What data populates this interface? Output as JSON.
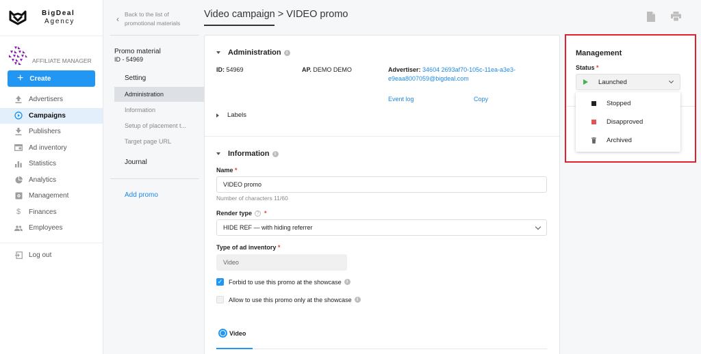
{
  "brand": {
    "name_line1": "BigDeal",
    "name_line2": "Agency",
    "role": "AFFILIATE MANAGER"
  },
  "sidebar": {
    "create_label": "Create",
    "items": [
      {
        "label": "Advertisers",
        "icon": "upload-icon",
        "active": false
      },
      {
        "label": "Campaigns",
        "icon": "play-circle-icon",
        "active": true
      },
      {
        "label": "Publishers",
        "icon": "download-icon",
        "active": false
      },
      {
        "label": "Ad inventory",
        "icon": "browser-window-icon",
        "active": false
      },
      {
        "label": "Statistics",
        "icon": "bar-chart-icon",
        "active": false
      },
      {
        "label": "Analytics",
        "icon": "pie-chart-icon",
        "active": false
      },
      {
        "label": "Management",
        "icon": "management-icon",
        "active": false
      },
      {
        "label": "Finances",
        "icon": "dollar-icon",
        "active": false
      },
      {
        "label": "Employees",
        "icon": "people-icon",
        "active": false
      }
    ],
    "logout_label": "Log out"
  },
  "subnav": {
    "back_line1": "Back to the list of",
    "back_line2": "promotional materials",
    "promo_title": "Promo material",
    "promo_id": "ID - 54969",
    "setting_label": "Setting",
    "items": [
      {
        "label": "Administration",
        "active": true
      },
      {
        "label": "Information",
        "active": false
      },
      {
        "label": "Setup of placement t...",
        "active": false
      },
      {
        "label": "Target page URL",
        "active": false
      }
    ],
    "journal_label": "Journal",
    "add_promo_label": "Add promo"
  },
  "header": {
    "title": "Video campaign > VIDEO promo"
  },
  "administration": {
    "title": "Administration",
    "id_label": "ID:",
    "id_value": "54969",
    "ap_label": "AP.",
    "ap_value": "DEMO DEMO",
    "advertiser_label": "Advertiser:",
    "advertiser_value_line1": "34604 2693af70-105c-11ea-a3e3-",
    "advertiser_value_line2": "e9eaa8007059@bigdeal.com",
    "event_log_label": "Event log",
    "copy_label": "Copy",
    "labels_title": "Labels"
  },
  "information": {
    "title": "Information",
    "name_label": "Name",
    "name_value": "VIDEO promo",
    "name_hint": "Number of characters 11/60",
    "render_type_label": "Render type",
    "render_type_value": "HIDE REF — with hiding referrer",
    "ad_inventory_label": "Type of ad inventory",
    "ad_inventory_value": "Video",
    "forbid_showcase_label": "Forbid to use this promo at the showcase",
    "forbid_showcase_checked": true,
    "only_showcase_label": "Allow to use this promo only at the showcase",
    "only_showcase_checked": false,
    "format_tab_label": "Video"
  },
  "management": {
    "title": "Management",
    "status_label": "Status",
    "status_value": "Launched",
    "status_options": [
      {
        "label": "Stopped",
        "icon": "stop-square-icon",
        "color": "#222222"
      },
      {
        "label": "Disapproved",
        "icon": "red-square-icon",
        "color": "#e05555"
      },
      {
        "label": "Archived",
        "icon": "trash-icon",
        "color": "#666666"
      }
    ]
  },
  "colors": {
    "accent": "#2196f3",
    "link": "#1e88e5",
    "required": "#e53935",
    "launched": "#4caf50",
    "highlight_border": "#e0202a"
  }
}
